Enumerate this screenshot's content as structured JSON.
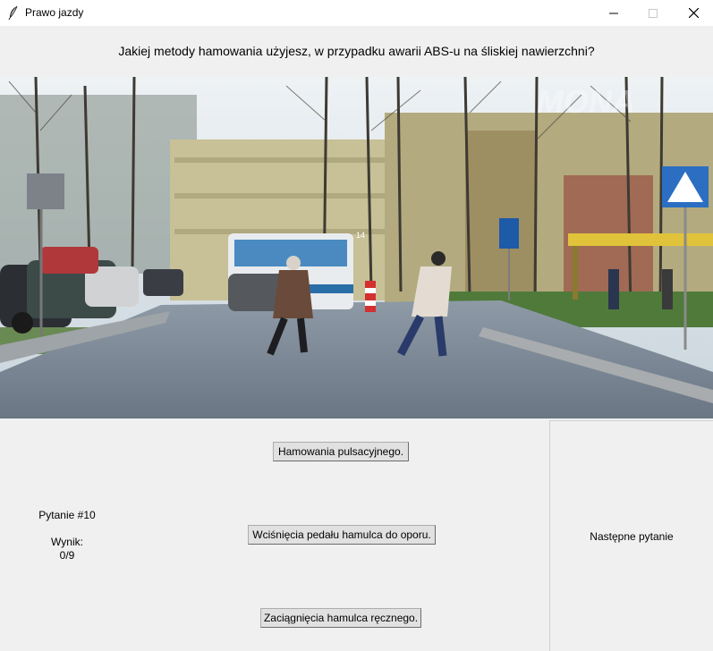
{
  "window": {
    "title": "Prawo jazdy",
    "icon": "feather-icon",
    "controls": [
      "minimize-icon",
      "maximize-icon",
      "close-icon"
    ]
  },
  "question": {
    "text": "Jakiej metody hamowania użyjesz, w przypadku awarii ABS-u na śliskiej nawierzchni?"
  },
  "image": {
    "watermark": "MONA",
    "bus_sign": "14"
  },
  "status": {
    "question_number": "Pytanie #10",
    "score_label": "Wynik:",
    "score_value": "0/9"
  },
  "answers": [
    {
      "label": "Hamowania pulsacyjnego."
    },
    {
      "label": "Wciśnięcia pedału hamulca do oporu."
    },
    {
      "label": "Zaciągnięcia hamulca ręcznego."
    }
  ],
  "next_button": {
    "label": "Następne pytanie"
  }
}
